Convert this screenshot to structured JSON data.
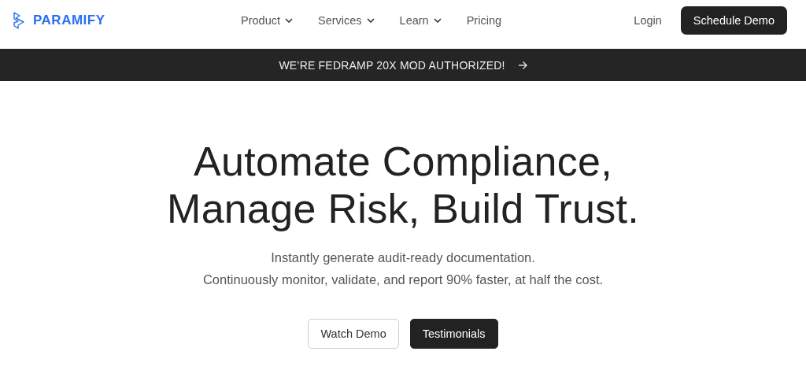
{
  "header": {
    "logo": "PARAMIFY",
    "nav": [
      {
        "label": "Product",
        "has_menu": true
      },
      {
        "label": "Services",
        "has_menu": true
      },
      {
        "label": "Learn",
        "has_menu": true
      },
      {
        "label": "Pricing",
        "has_menu": false
      }
    ],
    "login": "Login",
    "cta": "Schedule Demo"
  },
  "banner": {
    "text": "WE’RE FEDRAMP 20X MOD AUTHORIZED!"
  },
  "hero": {
    "headline": [
      "Automate Compliance,",
      "Manage Risk, Build Trust."
    ],
    "subtitle": [
      "Instantly generate audit-ready documentation.",
      "Continuously monitor, validate, and report 90% faster, at half the cost."
    ],
    "buttons": [
      {
        "label": "Watch Demo",
        "kind": "outline"
      },
      {
        "label": "Testimonials",
        "kind": "solid"
      }
    ]
  }
}
